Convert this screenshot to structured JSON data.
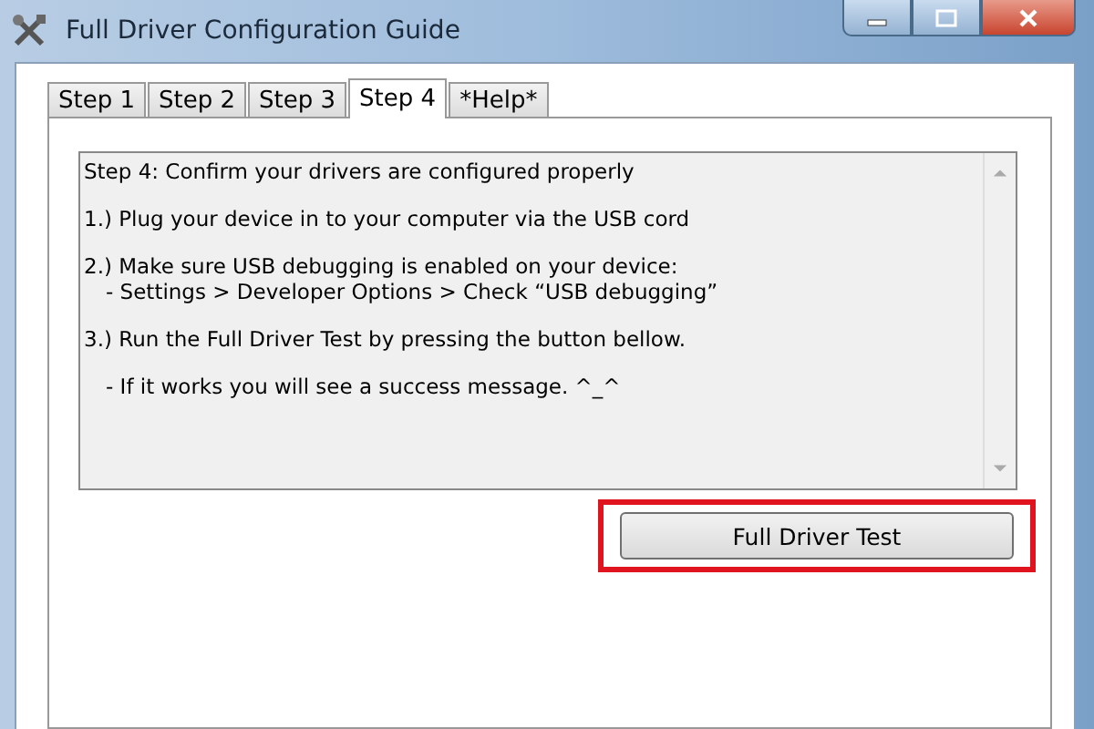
{
  "window": {
    "title": "Full Driver Configuration Guide"
  },
  "tabs": [
    {
      "label": "Step 1",
      "selected": false
    },
    {
      "label": "Step 2",
      "selected": false
    },
    {
      "label": "Step 3",
      "selected": false
    },
    {
      "label": "Step 4",
      "selected": true
    },
    {
      "label": "*Help*",
      "selected": false
    }
  ],
  "instructions": {
    "paragraphs": [
      {
        "lines": [
          {
            "text": "Step 4: Confirm your drivers are configured properly",
            "indent": false
          }
        ]
      },
      {
        "lines": [
          {
            "text": "1.) Plug your device in to your computer via the USB cord",
            "indent": false
          }
        ]
      },
      {
        "lines": [
          {
            "text": "2.) Make sure USB debugging is enabled on your device:",
            "indent": false
          },
          {
            "text": "- Settings > Developer Options > Check “USB debugging”",
            "indent": true
          }
        ]
      },
      {
        "lines": [
          {
            "text": "3.) Run the Full Driver Test by pressing the button bellow.",
            "indent": false
          }
        ]
      },
      {
        "lines": [
          {
            "text": "- If it works you will see a success message. ^_^",
            "indent": true
          }
        ]
      }
    ]
  },
  "test_button": {
    "label": "Full Driver Test",
    "highlighted": true
  }
}
